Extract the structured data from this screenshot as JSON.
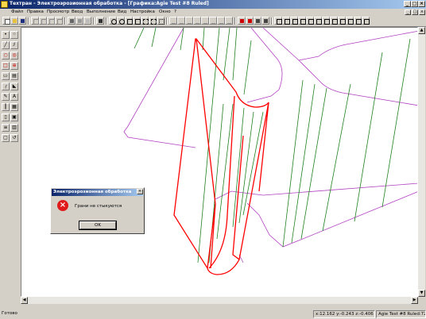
{
  "window": {
    "title": "Техтран - Электроэрозионная обработка - [Графика:Agie Test #8 Ruled]",
    "min": "_",
    "max": "□",
    "close": "×"
  },
  "menu": {
    "items": [
      "Файл",
      "Правка",
      "Просмотр",
      "Ввод",
      "Выполнение",
      "Вид",
      "Настройка",
      "Окно",
      "?"
    ]
  },
  "dialog": {
    "title": "Электроэрозионная обработка",
    "message": "Грани не стыкуются",
    "ok_label": "OK",
    "close": "×"
  },
  "status": {
    "ready": "Готово",
    "coords": "x:12.162 y:-0.243 z:-0.406",
    "model": "Agie Test #8 Ruled:72"
  },
  "colors": {
    "guide": "#b040c0",
    "ruling": "#208020",
    "highlight": "#ff0000"
  }
}
